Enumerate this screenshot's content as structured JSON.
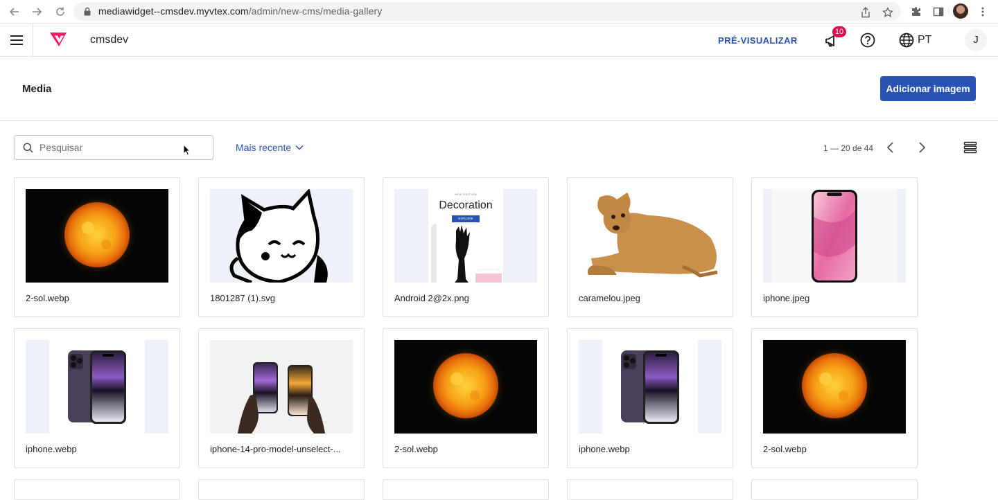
{
  "browser": {
    "url_host": "mediawidget--cmsdev.myvtex.com",
    "url_path": "/admin/new-cms/media-gallery"
  },
  "header": {
    "workspace": "cmsdev",
    "preview_label": "PRÉ-VISUALIZAR",
    "notification_count": "10",
    "language": "PT",
    "avatar_initial": "J"
  },
  "page": {
    "title": "Media",
    "add_button_label": "Adicionar imagem"
  },
  "toolbar": {
    "search_placeholder": "Pesquisar",
    "sort_label": "Mais recente",
    "pagination_label": "1 — 20 de 44"
  },
  "media": [
    {
      "name": "2-sol.webp",
      "thumb": "sun"
    },
    {
      "name": "1801287 (1).svg",
      "thumb": "cat"
    },
    {
      "name": "Android 2@2x.png",
      "thumb": "decoration"
    },
    {
      "name": "caramelou.jpeg",
      "thumb": "dog"
    },
    {
      "name": "iphone.jpeg",
      "thumb": "iphone-pink"
    },
    {
      "name": "iphone.webp",
      "thumb": "iphone-purple"
    },
    {
      "name": "iphone-14-pro-model-unselect-...",
      "thumb": "iphone-hands"
    },
    {
      "name": "2-sol.webp",
      "thumb": "sun"
    },
    {
      "name": "iphone.webp",
      "thumb": "iphone-purple"
    },
    {
      "name": "2-sol.webp",
      "thumb": "sun"
    }
  ],
  "thumb_texts": {
    "decoration_title": "Decoration",
    "decoration_button": "EXPLORE",
    "decoration_kicker": "NEW EDITION"
  },
  "colors": {
    "primary": "#2953b2",
    "badge": "#de0a4c",
    "vtex_brand": "#f71963"
  }
}
